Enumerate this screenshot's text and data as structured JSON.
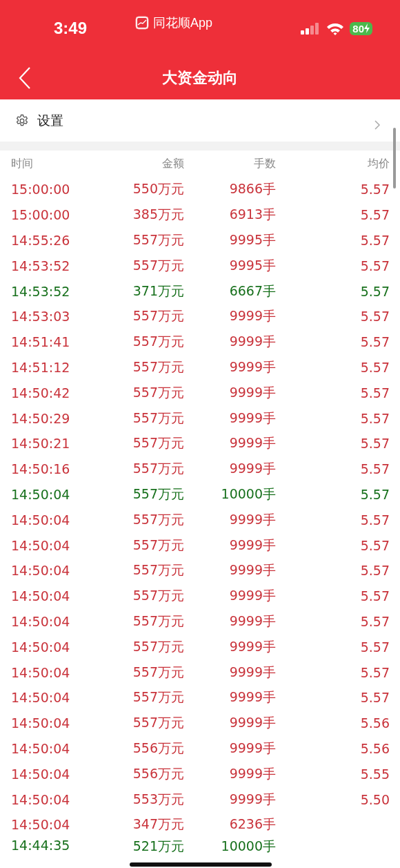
{
  "status_bar": {
    "time": "3:49",
    "app": "同花顺App",
    "battery": "80"
  },
  "nav": {
    "title": "大资金动向"
  },
  "settings": {
    "label": "设置"
  },
  "table": {
    "columns": [
      "时间",
      "金额",
      "手数",
      "均价"
    ],
    "rows": [
      {
        "time": "15:00:00",
        "amount": "550万元",
        "lots": "9866手",
        "price": "5.57",
        "color": "#c9333b"
      },
      {
        "time": "15:00:00",
        "amount": "385万元",
        "lots": "6913手",
        "price": "5.57",
        "color": "#c9333b"
      },
      {
        "time": "14:55:26",
        "amount": "557万元",
        "lots": "9995手",
        "price": "5.57",
        "color": "#c9333b"
      },
      {
        "time": "14:53:52",
        "amount": "557万元",
        "lots": "9995手",
        "price": "5.57",
        "color": "#c9333b"
      },
      {
        "time": "14:53:52",
        "amount": "371万元",
        "lots": "6667手",
        "price": "5.57",
        "color": "#17701c"
      },
      {
        "time": "14:53:03",
        "amount": "557万元",
        "lots": "9999手",
        "price": "5.57",
        "color": "#c9333b"
      },
      {
        "time": "14:51:41",
        "amount": "557万元",
        "lots": "9999手",
        "price": "5.57",
        "color": "#c9333b"
      },
      {
        "time": "14:51:12",
        "amount": "557万元",
        "lots": "9999手",
        "price": "5.57",
        "color": "#c9333b"
      },
      {
        "time": "14:50:42",
        "amount": "557万元",
        "lots": "9999手",
        "price": "5.57",
        "color": "#c9333b"
      },
      {
        "time": "14:50:29",
        "amount": "557万元",
        "lots": "9999手",
        "price": "5.57",
        "color": "#c9333b"
      },
      {
        "time": "14:50:21",
        "amount": "557万元",
        "lots": "9999手",
        "price": "5.57",
        "color": "#c9333b"
      },
      {
        "time": "14:50:16",
        "amount": "557万元",
        "lots": "9999手",
        "price": "5.57",
        "color": "#c9333b"
      },
      {
        "time": "14:50:04",
        "amount": "557万元",
        "lots": "10000手",
        "price": "5.57",
        "color": "#17701c"
      },
      {
        "time": "14:50:04",
        "amount": "557万元",
        "lots": "9999手",
        "price": "5.57",
        "color": "#c9333b"
      },
      {
        "time": "14:50:04",
        "amount": "557万元",
        "lots": "9999手",
        "price": "5.57",
        "color": "#c9333b"
      },
      {
        "time": "14:50:04",
        "amount": "557万元",
        "lots": "9999手",
        "price": "5.57",
        "color": "#c9333b"
      },
      {
        "time": "14:50:04",
        "amount": "557万元",
        "lots": "9999手",
        "price": "5.57",
        "color": "#c9333b"
      },
      {
        "time": "14:50:04",
        "amount": "557万元",
        "lots": "9999手",
        "price": "5.57",
        "color": "#c9333b"
      },
      {
        "time": "14:50:04",
        "amount": "557万元",
        "lots": "9999手",
        "price": "5.57",
        "color": "#c9333b"
      },
      {
        "time": "14:50:04",
        "amount": "557万元",
        "lots": "9999手",
        "price": "5.57",
        "color": "#c9333b"
      },
      {
        "time": "14:50:04",
        "amount": "557万元",
        "lots": "9999手",
        "price": "5.57",
        "color": "#c9333b"
      },
      {
        "time": "14:50:04",
        "amount": "557万元",
        "lots": "9999手",
        "price": "5.56",
        "color": "#c9333b"
      },
      {
        "time": "14:50:04",
        "amount": "556万元",
        "lots": "9999手",
        "price": "5.56",
        "color": "#c9333b"
      },
      {
        "time": "14:50:04",
        "amount": "556万元",
        "lots": "9999手",
        "price": "5.55",
        "color": "#c9333b"
      },
      {
        "time": "14:50:04",
        "amount": "553万元",
        "lots": "9999手",
        "price": "5.50",
        "color": "#c9333b"
      },
      {
        "time": "14:50:04",
        "amount": "347万元",
        "lots": "6236手",
        "color": "#c9333b"
      },
      {
        "time": "14:44:35",
        "amount": "521万元",
        "lots": "10000手",
        "color": "#17701c"
      }
    ]
  }
}
